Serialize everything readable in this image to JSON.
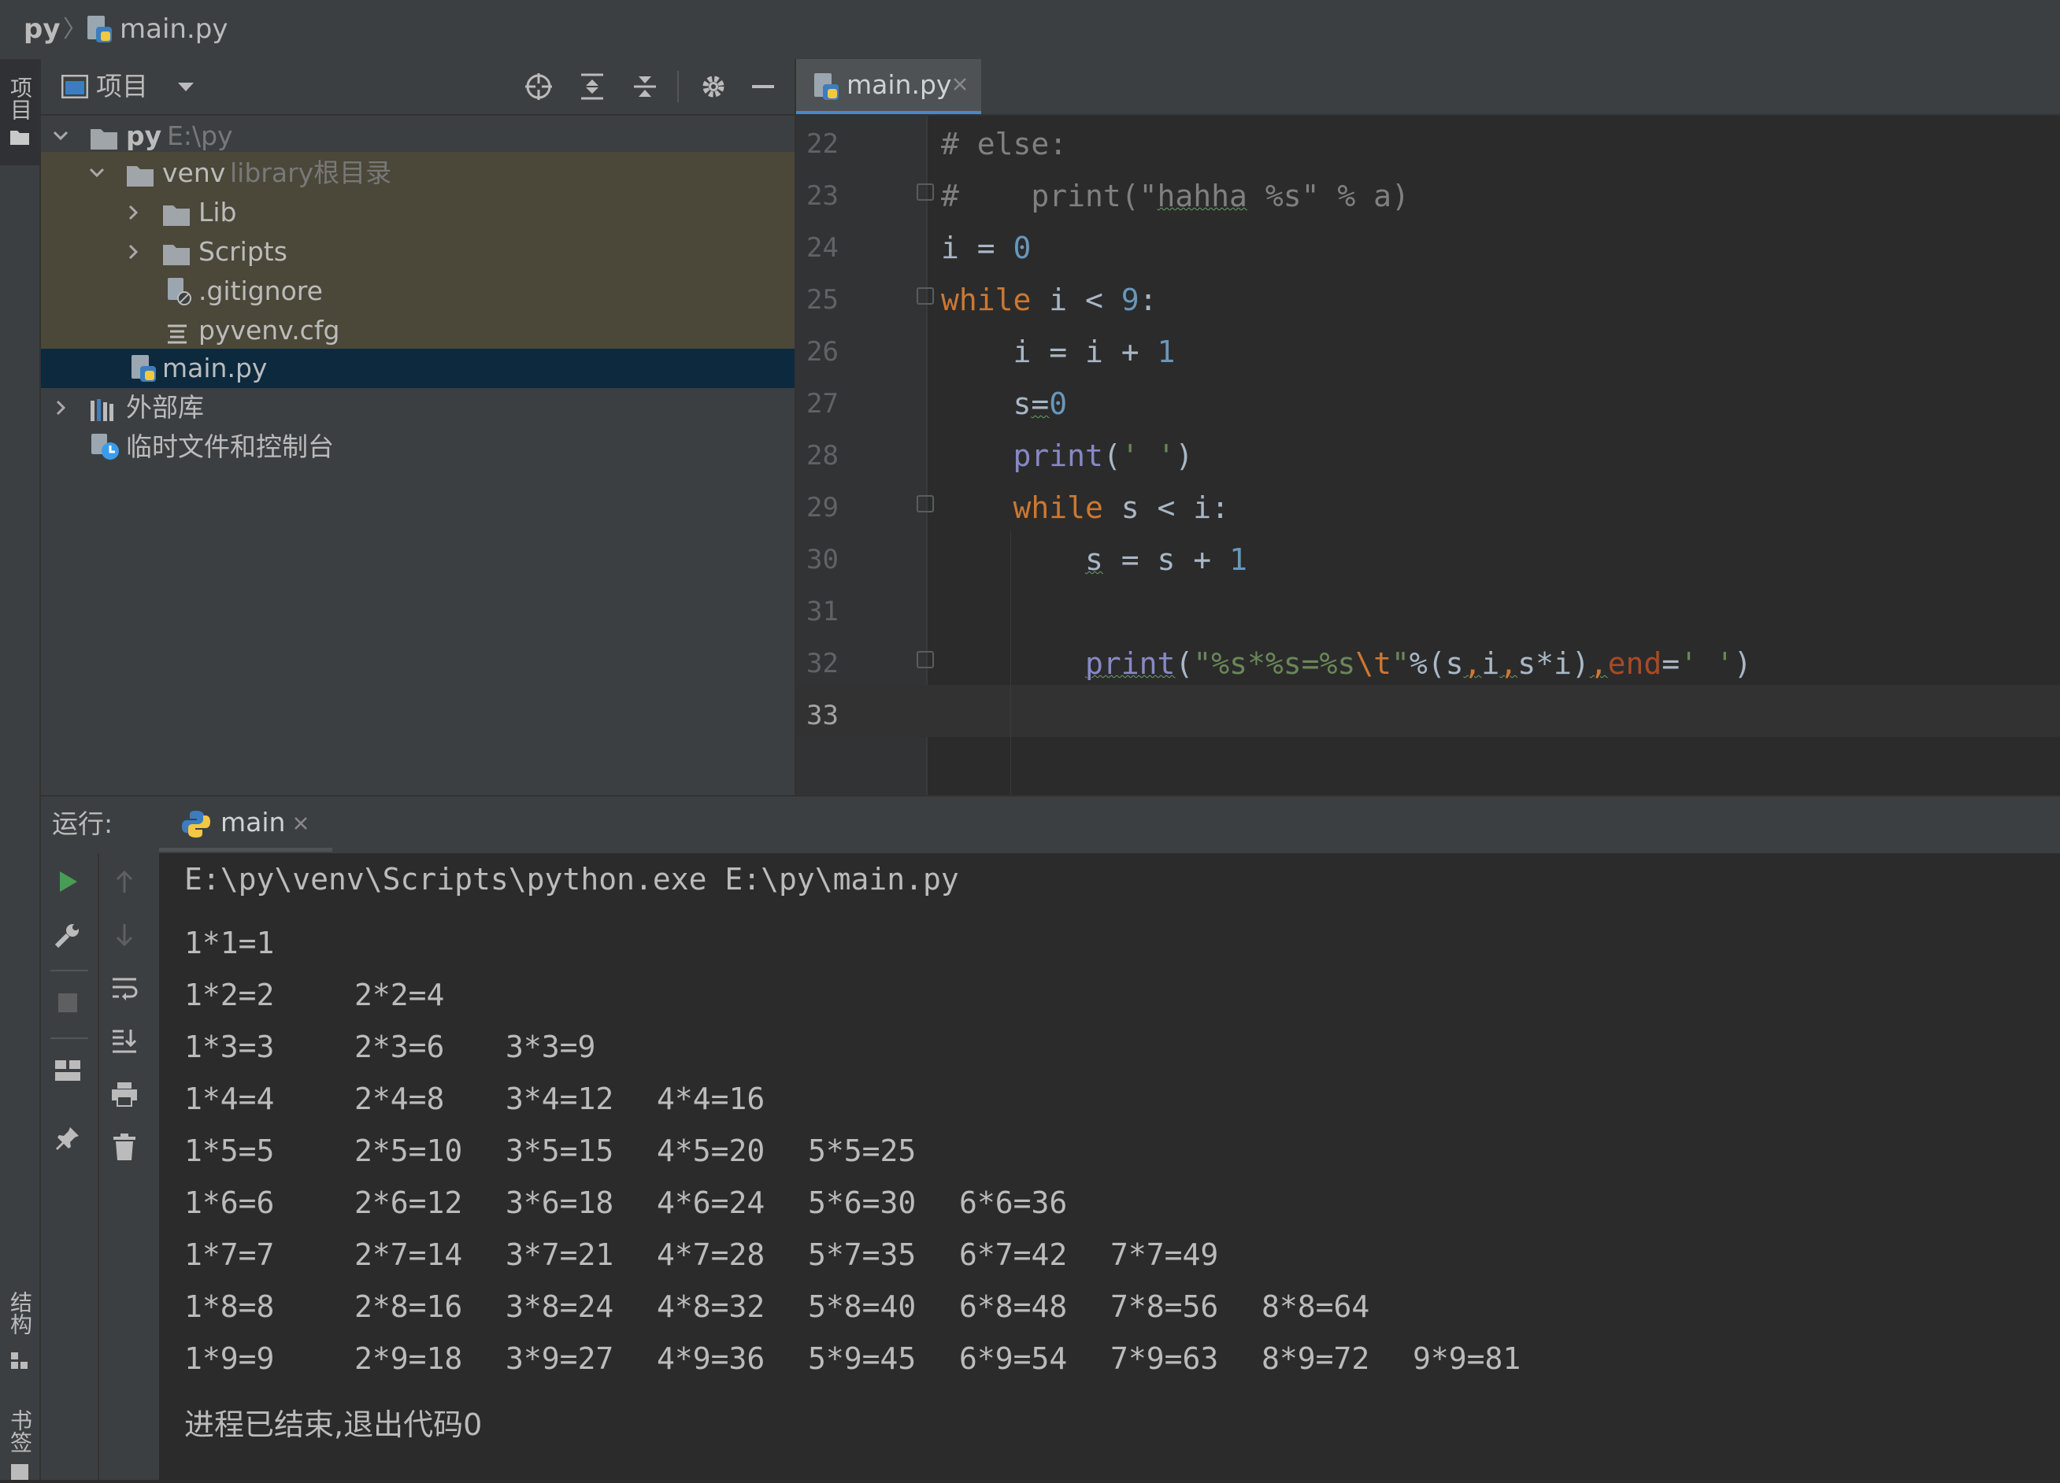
{
  "breadcrumb": {
    "project": "py",
    "file": "main.py"
  },
  "sidebar_tabs": {
    "project": "项目",
    "structure": "结构",
    "bookmarks": "书签"
  },
  "project_panel": {
    "title": "项目",
    "tree": [
      {
        "label": "py",
        "hint": "E:\\py",
        "expanded": true,
        "icon": "folder-icon"
      },
      {
        "label": "venv",
        "hint": "library根目录",
        "expanded": true,
        "icon": "folder-icon"
      },
      {
        "label": "Lib",
        "hint": "",
        "expanded": false,
        "icon": "folder-icon"
      },
      {
        "label": "Scripts",
        "hint": "",
        "expanded": false,
        "icon": "folder-icon"
      },
      {
        "label": ".gitignore",
        "hint": "",
        "icon": "gitignore-file-icon"
      },
      {
        "label": "pyvenv.cfg",
        "hint": "",
        "icon": "config-file-icon"
      },
      {
        "label": "main.py",
        "hint": "",
        "icon": "python-file-icon",
        "selected": true
      },
      {
        "label": "外部库",
        "hint": "",
        "expanded": false,
        "icon": "library-icon"
      },
      {
        "label": "临时文件和控制台",
        "hint": "",
        "icon": "scratches-icon"
      }
    ]
  },
  "editor": {
    "tab": "main.py",
    "line_numbers": [
      "22",
      "23",
      "24",
      "25",
      "26",
      "27",
      "28",
      "29",
      "30",
      "31",
      "32",
      "33"
    ]
  },
  "run_panel": {
    "label": "运行:",
    "tab": "main",
    "command": "E:\\py\\venv\\Scripts\\python.exe E:\\py\\main.py",
    "table": [
      [
        "1*1=1"
      ],
      [
        "1*2=2",
        "2*2=4"
      ],
      [
        "1*3=3",
        "2*3=6",
        "3*3=9"
      ],
      [
        "1*4=4",
        "2*4=8",
        "3*4=12",
        "4*4=16"
      ],
      [
        "1*5=5",
        "2*5=10",
        "3*5=15",
        "4*5=20",
        "5*5=25"
      ],
      [
        "1*6=6",
        "2*6=12",
        "3*6=18",
        "4*6=24",
        "5*6=30",
        "6*6=36"
      ],
      [
        "1*7=7",
        "2*7=14",
        "3*7=21",
        "4*7=28",
        "5*7=35",
        "6*7=42",
        "7*7=49"
      ],
      [
        "1*8=8",
        "2*8=16",
        "3*8=24",
        "4*8=32",
        "5*8=40",
        "6*8=48",
        "7*8=56",
        "8*8=64"
      ],
      [
        "1*9=9",
        "2*9=18",
        "3*9=27",
        "4*9=36",
        "5*9=45",
        "6*9=54",
        "7*9=63",
        "8*9=72",
        "9*9=81"
      ]
    ],
    "exit_message": "进程已结束,退出代码0"
  },
  "colors": {
    "keyword": "#cc7832",
    "number": "#6897bb",
    "string": "#6a8759",
    "builtin": "#8888c6",
    "comment": "#808080",
    "selection": "#0d293e"
  }
}
